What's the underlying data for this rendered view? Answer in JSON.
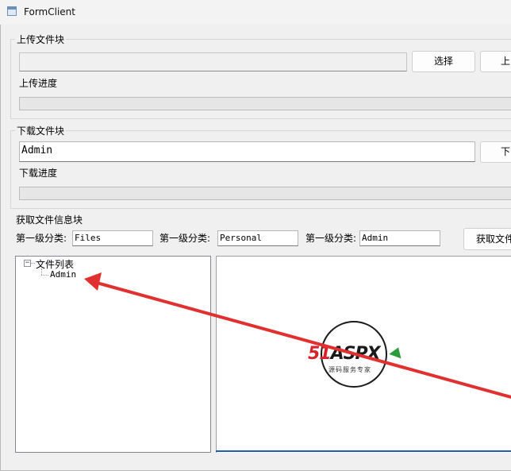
{
  "window": {
    "title": "FormClient",
    "icon": "form-window-icon"
  },
  "upload": {
    "group_title": "上传文件块",
    "path_value": "",
    "select_label": "选择",
    "upload_label": "上",
    "progress_label": "上传进度",
    "progress_value": 0
  },
  "download": {
    "group_title": "下载文件块",
    "name_value": "Admin",
    "download_label": "下",
    "progress_label": "下载进度",
    "progress_value": 0
  },
  "info": {
    "group_title": "获取文件信息块",
    "category1_label": "第一级分类:",
    "category1_value": "Files",
    "category2_label": "第一级分类:",
    "category2_value": "Personal",
    "category3_label": "第一级分类:",
    "category3_value": "Admin",
    "get_info_label": "获取文件",
    "tree": {
      "root_label": "文件列表",
      "root_toggle": "−",
      "children": [
        "Admin"
      ]
    }
  },
  "logo": {
    "brand_prefix": "51",
    "brand_suffix": "ASPX",
    "tagline": "源码服务专家",
    "colors": {
      "prefix": "#d9212a",
      "suffix": "#1a1a1a",
      "accent": "#2a9d3a"
    }
  },
  "annotation": {
    "arrow_color": "#e03030"
  }
}
